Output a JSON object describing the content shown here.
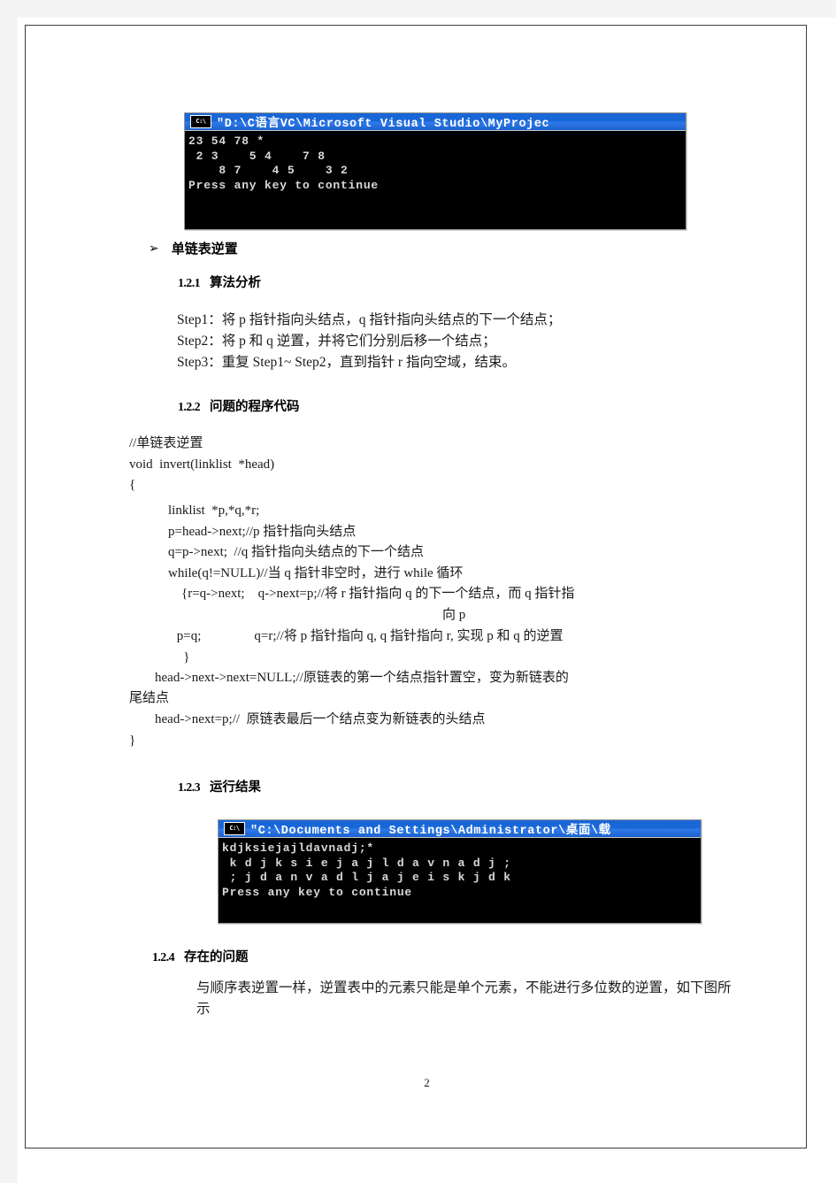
{
  "page": {
    "number": "2"
  },
  "console_1": {
    "icon": "console-window-icon",
    "icon_label": "C:\\",
    "title": "\"D:\\C语言VC\\Microsoft Visual Studio\\MyProjec",
    "lines": [
      "23 54 78 *",
      " 2 3    5 4    7 8",
      "    8 7    4 5    3 2",
      "Press any key to continue"
    ]
  },
  "console_2": {
    "icon": "console-window-icon",
    "icon_label": "C:\\",
    "title": "\"C:\\Documents and Settings\\Administrator\\桌面\\载",
    "lines": [
      "kdjksiejajldavnadj;*",
      " k d j k s i e j a j l d a v n a d j ;",
      " ; j d a n v a d l j a j e i s k j d k",
      "Press any key to continue"
    ]
  },
  "section_bullet": {
    "glyph": "➢",
    "label": "单链表逆置"
  },
  "section_1_2_1": {
    "number": "1.2.1",
    "title": "算法分析",
    "steps": [
      "Step1：将 p 指针指向头结点，q 指针指向头结点的下一个结点；",
      "Step2：将 p 和 q 逆置，并将它们分别后移一个结点；",
      "Step3：重复 Step1~ Step2，直到指针 r 指向空域，结束。"
    ]
  },
  "section_1_2_2": {
    "number": "1.2.2",
    "title": "问题的程序代码",
    "code_block_1": "//单链表逆置\nvoid  invert(linklist  *head)\n{",
    "code_block_2": "linklist  *p,*q,*r;\np=head->next;//p 指针指向头结点\nq=p->next;  //q 指针指向头结点的下一个结点\nwhile(q!=NULL)//当 q 指针非空时，进行 while 循环\n    {r=q->next;    q->next=p;//将 r 指针指向 q 的下一个结点，而 q 指针指",
    "code_wrap_1": "向 p",
    "code_block_3": " p=q;                q=r;//将 p 指针指向 q, q 指针指向 r, 实现 p 和 q 的逆置\n   }",
    "code_block_4": "head->next->next=NULL;//原链表的第一个结点指针置空，变为新链表的",
    "code_wrap_2": "尾结点",
    "code_block_5": "head->next=p;//  原链表最后一个结点变为新链表的头结点",
    "code_block_6": "}"
  },
  "section_1_2_3": {
    "number": "1.2.3",
    "title": "运行结果"
  },
  "section_1_2_4": {
    "number": "1.2.4",
    "title": "存在的问题",
    "paragraph": "与顺序表逆置一样，逆置表中的元素只能是单个元素，不能进行多位数的逆置，如下图所示"
  }
}
